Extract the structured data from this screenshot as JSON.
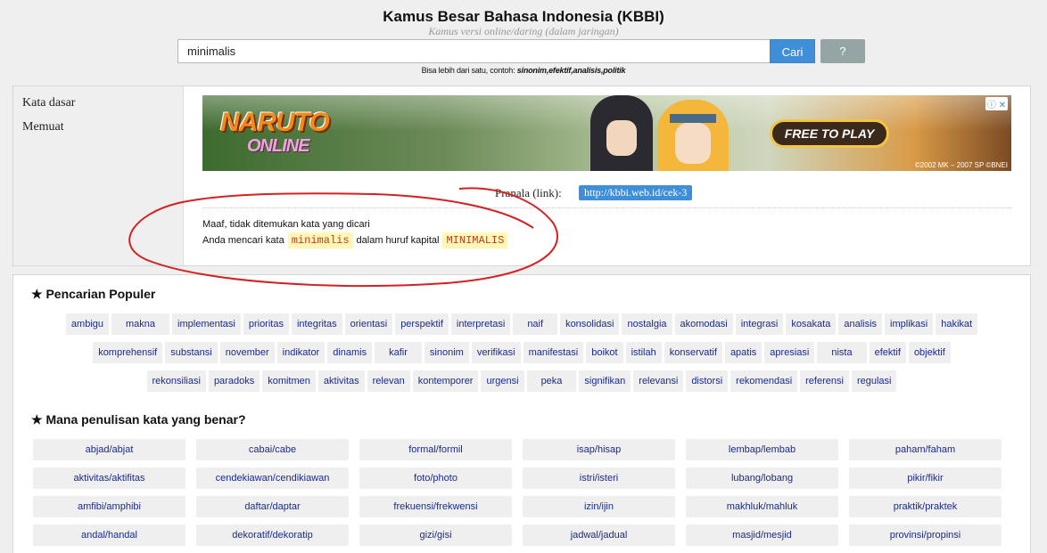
{
  "header": {
    "title": "Kamus Besar Bahasa Indonesia (KBBI)",
    "subtitle": "Kamus versi online/daring (dalam jaringan)",
    "search_value": "minimalis",
    "search_button": "Cari",
    "help_button": "?",
    "hint_prefix": "Bisa lebih dari satu, contoh:",
    "hint_examples": "sinonim,efektif,analisis,politik"
  },
  "sidebar": {
    "items": [
      {
        "label": "Kata dasar"
      },
      {
        "label": "Memuat"
      }
    ]
  },
  "ad": {
    "logo_main": "NARUTO",
    "logo_sub": "ONLINE",
    "cta": "FREE TO PLAY",
    "copyright": "©2002 MK – 2007 SP ©BNEI",
    "info_icon": "info-icon"
  },
  "result": {
    "pranala_label": "Pranala (link):",
    "pranala_url": "http://kbbi.web.id/cek-3",
    "not_found": "Maaf, tidak ditemukan kata yang dicari",
    "search_prefix": "Anda mencari kata",
    "keyword": "minimalis",
    "search_middle": "dalam huruf kapital",
    "keyword_upper": "MINIMALIS"
  },
  "annotation": {
    "color": "#d42020"
  },
  "popular": {
    "title": "★ Pencarian Populer",
    "rows": [
      [
        "ambigu",
        "makna",
        "implementasi",
        "prioritas",
        "integritas",
        "orientasi",
        "perspektif",
        "interpretasi",
        "naif",
        "konsolidasi",
        "nostalgia",
        "akomodasi",
        "integrasi",
        "kosakata",
        "analisis",
        "implikasi",
        "hakikat"
      ],
      [
        "komprehensif",
        "substansi",
        "november",
        "indikator",
        "dinamis",
        "kafir",
        "sinonim",
        "verifikasi",
        "manifestasi",
        "boikot",
        "istilah",
        "konservatif",
        "apatis",
        "apresiasi",
        "nista",
        "efektif",
        "objektif"
      ],
      [
        "rekonsiliasi",
        "paradoks",
        "komitmen",
        "aktivitas",
        "relevan",
        "kontemporer",
        "urgensi",
        "peka",
        "signifikan",
        "relevansi",
        "distorsi",
        "rekomendasi",
        "referensi",
        "regulasi"
      ]
    ]
  },
  "spelling": {
    "title": "★ Mana penulisan kata yang benar?",
    "items": [
      "abjad/abjat",
      "cabai/cabe",
      "formal/formil",
      "isap/hisap",
      "lembap/lembab",
      "paham/faham",
      "aktivitas/aktifitas",
      "cendekiawan/cendikiawan",
      "foto/photo",
      "istri/isteri",
      "lubang/lobang",
      "pikir/fikir",
      "amfibi/amphibi",
      "daftar/daptar",
      "frekuensi/frekwensi",
      "izin/ijin",
      "makhluk/mahluk",
      "praktik/praktek",
      "andal/handal",
      "dekoratif/dekoratip",
      "gizi/gisi",
      "jadwal/jadual",
      "masjid/mesjid",
      "provinsi/propinsi"
    ]
  }
}
